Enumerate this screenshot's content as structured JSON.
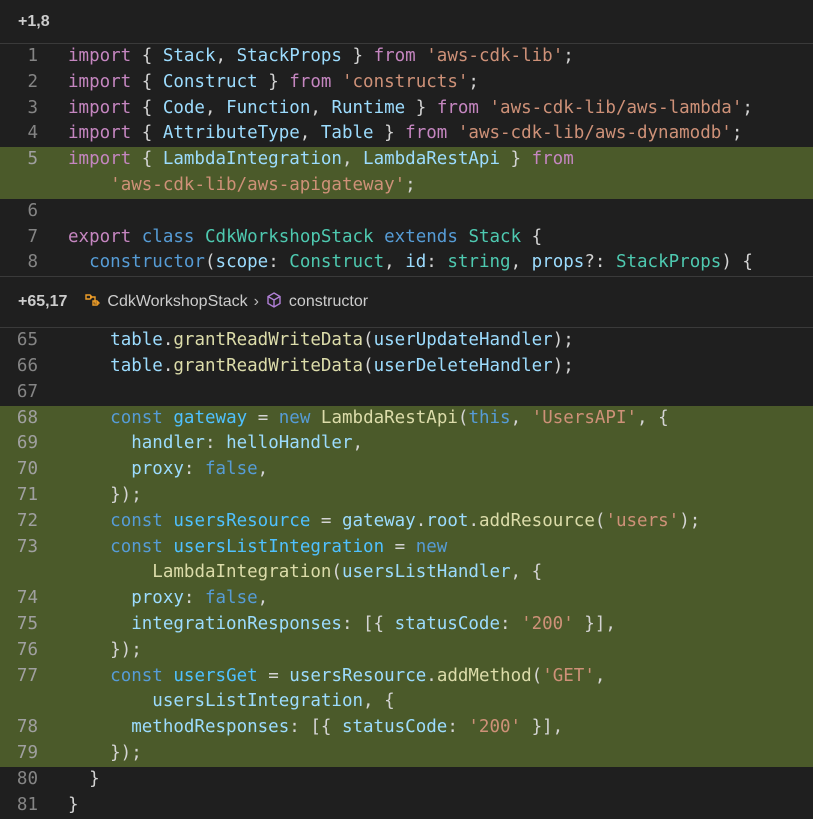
{
  "hunks": [
    {
      "range": "+1,8",
      "breadcrumb": [],
      "lines": [
        {
          "num": "1",
          "added": false,
          "tokens": [
            [
              "kw",
              "import"
            ],
            [
              "pu",
              " { "
            ],
            [
              "va",
              "Stack"
            ],
            [
              "pu",
              ", "
            ],
            [
              "va",
              "StackProps"
            ],
            [
              "pu",
              " } "
            ],
            [
              "kw",
              "from"
            ],
            [
              "pu",
              " "
            ],
            [
              "st",
              "'aws-cdk-lib'"
            ],
            [
              "pu",
              ";"
            ]
          ]
        },
        {
          "num": "2",
          "added": false,
          "tokens": [
            [
              "kw",
              "import"
            ],
            [
              "pu",
              " { "
            ],
            [
              "va",
              "Construct"
            ],
            [
              "pu",
              " } "
            ],
            [
              "kw",
              "from"
            ],
            [
              "pu",
              " "
            ],
            [
              "st",
              "'constructs'"
            ],
            [
              "pu",
              ";"
            ]
          ]
        },
        {
          "num": "3",
          "added": false,
          "tokens": [
            [
              "kw",
              "import"
            ],
            [
              "pu",
              " { "
            ],
            [
              "va",
              "Code"
            ],
            [
              "pu",
              ", "
            ],
            [
              "va",
              "Function"
            ],
            [
              "pu",
              ", "
            ],
            [
              "va",
              "Runtime"
            ],
            [
              "pu",
              " } "
            ],
            [
              "kw",
              "from"
            ],
            [
              "pu",
              " "
            ],
            [
              "st",
              "'aws-cdk-lib/aws-lambda'"
            ],
            [
              "pu",
              ";"
            ]
          ]
        },
        {
          "num": "4",
          "added": false,
          "tokens": [
            [
              "kw",
              "import"
            ],
            [
              "pu",
              " { "
            ],
            [
              "va",
              "AttributeType"
            ],
            [
              "pu",
              ", "
            ],
            [
              "va",
              "Table"
            ],
            [
              "pu",
              " } "
            ],
            [
              "kw",
              "from"
            ],
            [
              "pu",
              " "
            ],
            [
              "st",
              "'aws-cdk-lib/aws-dynamodb'"
            ],
            [
              "pu",
              ";"
            ]
          ]
        },
        {
          "num": "5",
          "added": true,
          "tokens": [
            [
              "kw",
              "import"
            ],
            [
              "pu",
              " { "
            ],
            [
              "va",
              "LambdaIntegration"
            ],
            [
              "pu",
              ", "
            ],
            [
              "va",
              "LambdaRestApi"
            ],
            [
              "pu",
              " } "
            ],
            [
              "kw",
              "from"
            ]
          ]
        },
        {
          "num": "",
          "added": true,
          "tokens": [
            [
              "pu",
              "    "
            ],
            [
              "st",
              "'aws-cdk-lib/aws-apigateway'"
            ],
            [
              "pu",
              ";"
            ]
          ]
        },
        {
          "num": "6",
          "added": false,
          "tokens": []
        },
        {
          "num": "7",
          "added": false,
          "tokens": [
            [
              "kw",
              "export"
            ],
            [
              "pu",
              " "
            ],
            [
              "kw2",
              "class"
            ],
            [
              "pu",
              " "
            ],
            [
              "ty",
              "CdkWorkshopStack"
            ],
            [
              "pu",
              " "
            ],
            [
              "kw2",
              "extends"
            ],
            [
              "pu",
              " "
            ],
            [
              "ty",
              "Stack"
            ],
            [
              "pu",
              " {"
            ]
          ]
        },
        {
          "num": "8",
          "added": false,
          "tokens": [
            [
              "pu",
              "  "
            ],
            [
              "kw2",
              "constructor"
            ],
            [
              "pu",
              "("
            ],
            [
              "va",
              "scope"
            ],
            [
              "pu",
              ": "
            ],
            [
              "ty",
              "Construct"
            ],
            [
              "pu",
              ", "
            ],
            [
              "va",
              "id"
            ],
            [
              "pu",
              ": "
            ],
            [
              "ty",
              "string"
            ],
            [
              "pu",
              ", "
            ],
            [
              "va",
              "props"
            ],
            [
              "pu",
              "?: "
            ],
            [
              "ty",
              "StackProps"
            ],
            [
              "pu",
              ") {"
            ]
          ]
        }
      ]
    },
    {
      "range": "+65,17",
      "breadcrumb": [
        "CdkWorkshopStack",
        "constructor"
      ],
      "lines": [
        {
          "num": "65",
          "added": false,
          "tokens": [
            [
              "pu",
              "    "
            ],
            [
              "va",
              "table"
            ],
            [
              "pu",
              "."
            ],
            [
              "fn",
              "grantReadWriteData"
            ],
            [
              "pu",
              "("
            ],
            [
              "va",
              "userUpdateHandler"
            ],
            [
              "pu",
              ");"
            ]
          ]
        },
        {
          "num": "66",
          "added": false,
          "tokens": [
            [
              "pu",
              "    "
            ],
            [
              "va",
              "table"
            ],
            [
              "pu",
              "."
            ],
            [
              "fn",
              "grantReadWriteData"
            ],
            [
              "pu",
              "("
            ],
            [
              "va",
              "userDeleteHandler"
            ],
            [
              "pu",
              ");"
            ]
          ]
        },
        {
          "num": "67",
          "added": false,
          "tokens": []
        },
        {
          "num": "68",
          "added": true,
          "tokens": [
            [
              "pu",
              "    "
            ],
            [
              "kw2",
              "const"
            ],
            [
              "pu",
              " "
            ],
            [
              "con",
              "gateway"
            ],
            [
              "pu",
              " = "
            ],
            [
              "kw2",
              "new"
            ],
            [
              "pu",
              " "
            ],
            [
              "fn",
              "LambdaRestApi"
            ],
            [
              "pu",
              "("
            ],
            [
              "kw2",
              "this"
            ],
            [
              "pu",
              ", "
            ],
            [
              "st",
              "'UsersAPI'"
            ],
            [
              "pu",
              ", {"
            ]
          ]
        },
        {
          "num": "69",
          "added": true,
          "tokens": [
            [
              "pu",
              "      "
            ],
            [
              "va",
              "handler"
            ],
            [
              "pu",
              ": "
            ],
            [
              "va",
              "helloHandler"
            ],
            [
              "pu",
              ","
            ]
          ]
        },
        {
          "num": "70",
          "added": true,
          "tokens": [
            [
              "pu",
              "      "
            ],
            [
              "va",
              "proxy"
            ],
            [
              "pu",
              ": "
            ],
            [
              "kw2",
              "false"
            ],
            [
              "pu",
              ","
            ]
          ]
        },
        {
          "num": "71",
          "added": true,
          "tokens": [
            [
              "pu",
              "    });"
            ]
          ]
        },
        {
          "num": "72",
          "added": true,
          "tokens": [
            [
              "pu",
              "    "
            ],
            [
              "kw2",
              "const"
            ],
            [
              "pu",
              " "
            ],
            [
              "con",
              "usersResource"
            ],
            [
              "pu",
              " = "
            ],
            [
              "va",
              "gateway"
            ],
            [
              "pu",
              "."
            ],
            [
              "va",
              "root"
            ],
            [
              "pu",
              "."
            ],
            [
              "fn",
              "addResource"
            ],
            [
              "pu",
              "("
            ],
            [
              "st",
              "'users'"
            ],
            [
              "pu",
              ");"
            ]
          ]
        },
        {
          "num": "73",
          "added": true,
          "tokens": [
            [
              "pu",
              "    "
            ],
            [
              "kw2",
              "const"
            ],
            [
              "pu",
              " "
            ],
            [
              "con",
              "usersListIntegration"
            ],
            [
              "pu",
              " = "
            ],
            [
              "kw2",
              "new"
            ]
          ]
        },
        {
          "num": "",
          "added": true,
          "tokens": [
            [
              "pu",
              "        "
            ],
            [
              "fn",
              "LambdaIntegration"
            ],
            [
              "pu",
              "("
            ],
            [
              "va",
              "usersListHandler"
            ],
            [
              "pu",
              ", {"
            ]
          ]
        },
        {
          "num": "74",
          "added": true,
          "tokens": [
            [
              "pu",
              "      "
            ],
            [
              "va",
              "proxy"
            ],
            [
              "pu",
              ": "
            ],
            [
              "kw2",
              "false"
            ],
            [
              "pu",
              ","
            ]
          ]
        },
        {
          "num": "75",
          "added": true,
          "tokens": [
            [
              "pu",
              "      "
            ],
            [
              "va",
              "integrationResponses"
            ],
            [
              "pu",
              ": [{ "
            ],
            [
              "va",
              "statusCode"
            ],
            [
              "pu",
              ": "
            ],
            [
              "st",
              "'200'"
            ],
            [
              "pu",
              " }],"
            ]
          ]
        },
        {
          "num": "76",
          "added": true,
          "tokens": [
            [
              "pu",
              "    });"
            ]
          ]
        },
        {
          "num": "77",
          "added": true,
          "tokens": [
            [
              "pu",
              "    "
            ],
            [
              "kw2",
              "const"
            ],
            [
              "pu",
              " "
            ],
            [
              "con",
              "usersGet"
            ],
            [
              "pu",
              " = "
            ],
            [
              "va",
              "usersResource"
            ],
            [
              "pu",
              "."
            ],
            [
              "fn",
              "addMethod"
            ],
            [
              "pu",
              "("
            ],
            [
              "st",
              "'GET'"
            ],
            [
              "pu",
              ","
            ]
          ]
        },
        {
          "num": "",
          "added": true,
          "tokens": [
            [
              "pu",
              "        "
            ],
            [
              "va",
              "usersListIntegration"
            ],
            [
              "pu",
              ", {"
            ]
          ]
        },
        {
          "num": "78",
          "added": true,
          "tokens": [
            [
              "pu",
              "      "
            ],
            [
              "va",
              "methodResponses"
            ],
            [
              "pu",
              ": [{ "
            ],
            [
              "va",
              "statusCode"
            ],
            [
              "pu",
              ": "
            ],
            [
              "st",
              "'200'"
            ],
            [
              "pu",
              " }],"
            ]
          ]
        },
        {
          "num": "79",
          "added": true,
          "tokens": [
            [
              "pu",
              "    });"
            ]
          ]
        },
        {
          "num": "80",
          "added": false,
          "tokens": [
            [
              "pu",
              "  }"
            ]
          ]
        },
        {
          "num": "81",
          "added": false,
          "tokens": [
            [
              "pu",
              "}"
            ]
          ]
        }
      ]
    }
  ]
}
